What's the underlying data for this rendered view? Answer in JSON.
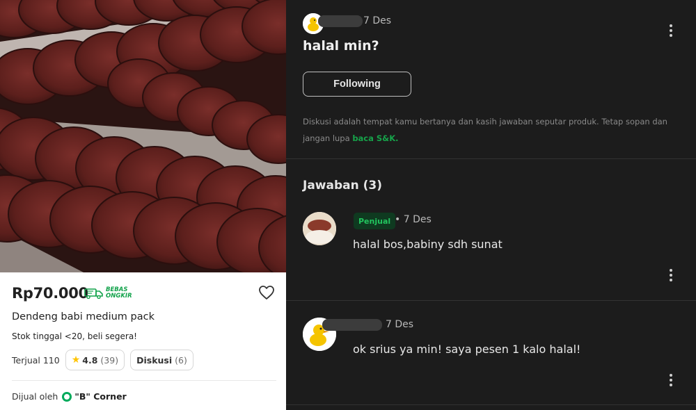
{
  "product": {
    "price": "Rp70.000",
    "bebas_ongkir_line1": "BEBAS",
    "bebas_ongkir_line2": "ONGKIR",
    "title": "Dendeng babi medium pack",
    "stock_text": "Stok tinggal <20, beli segera!",
    "sold_text": "Terjual 110",
    "rating": "4.8",
    "rating_count": "(39)",
    "discussion_label": "Diskusi",
    "discussion_count": "(6)",
    "seller_prefix": "Dijual oleh",
    "seller_name": "\"B\" Corner",
    "heart_icon": "heart-outline-icon",
    "accent_color": "#11a24a"
  },
  "discussion": {
    "question_date": "7 Des",
    "question": "halal min?",
    "follow_label": "Following",
    "info_text": "Diskusi adalah tempat kamu bertanya dan kasih jawaban seputar produk. Tetap sopan dan jangan lupa ",
    "info_link": "baca S&K.",
    "answers_title": "Jawaban (3)",
    "answers": [
      {
        "role_badge": "Penjual",
        "date": "• 7 Des",
        "text": "halal bos,babiny sdh sunat"
      },
      {
        "role_badge": "",
        "date": "7 Des",
        "text": "ok srius ya min! saya pesen 1 kalo halal!"
      }
    ],
    "link_color": "#16a34a"
  }
}
